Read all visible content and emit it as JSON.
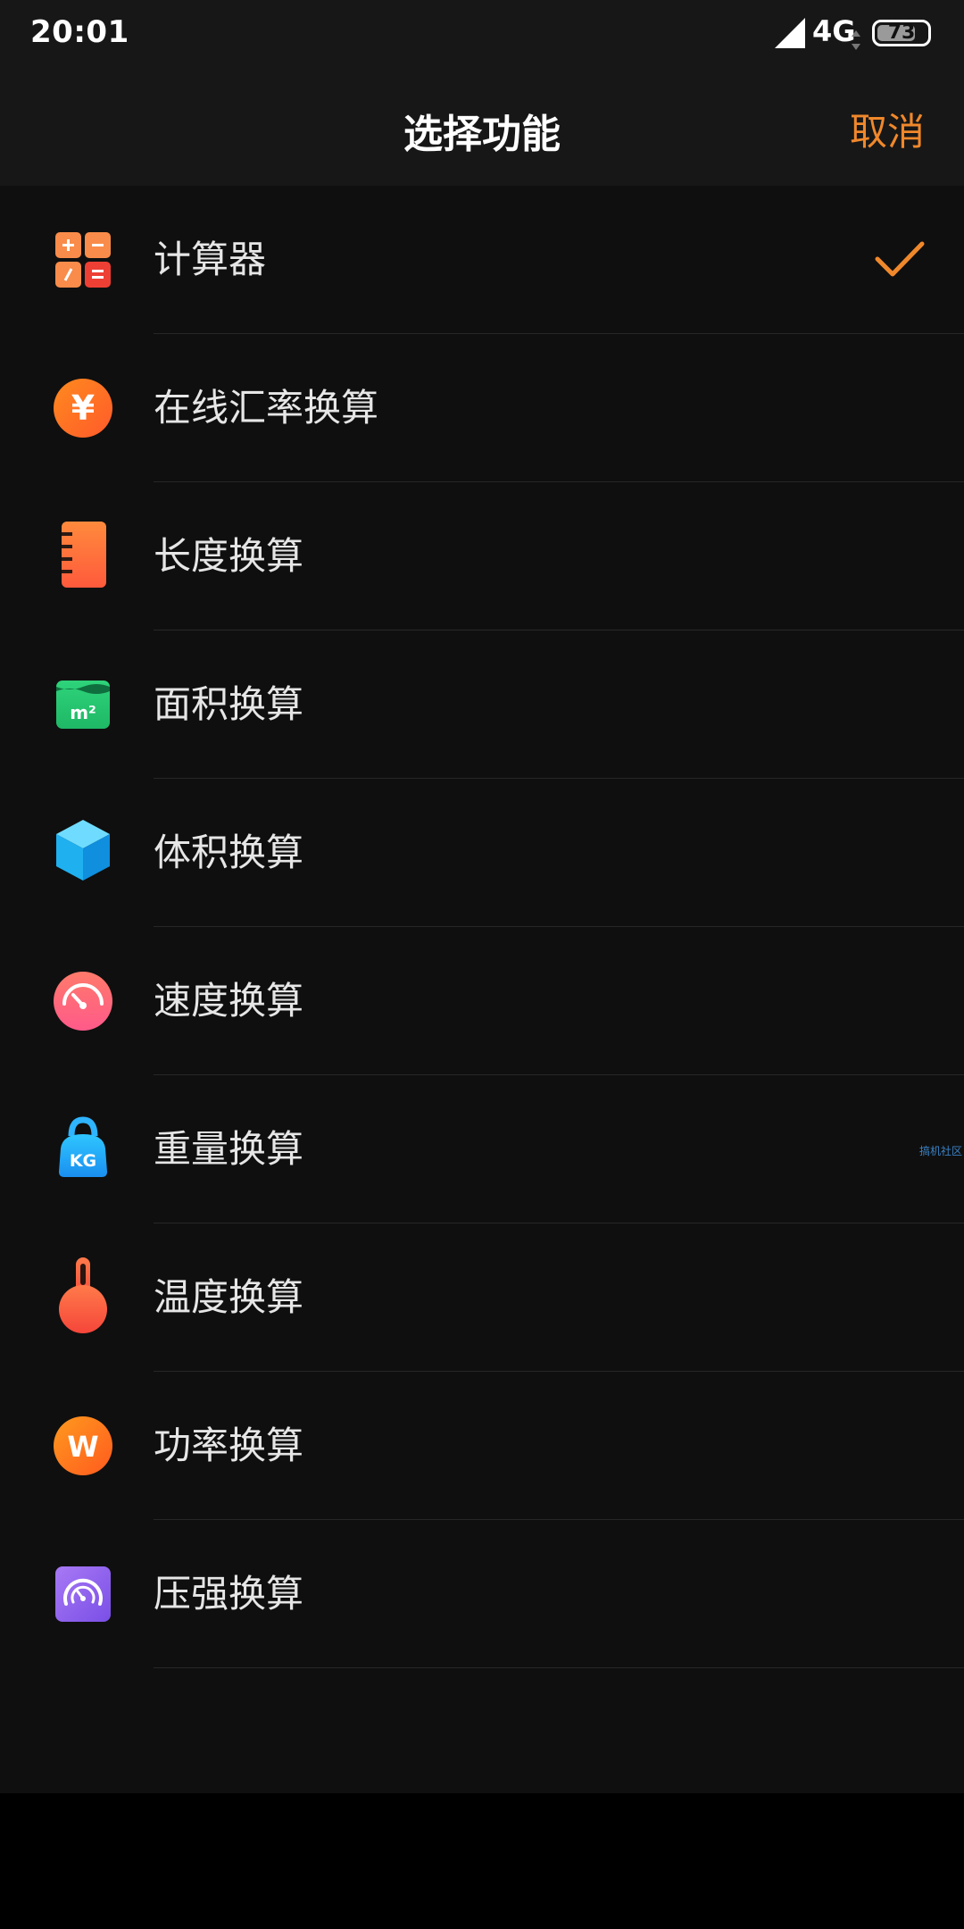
{
  "status_bar": {
    "time": "20:01",
    "network": "4G",
    "battery": "73"
  },
  "header": {
    "title": "选择功能",
    "cancel_label": "取消"
  },
  "items": [
    {
      "label": "计算器",
      "icon": "calculator-icon",
      "selected": true
    },
    {
      "label": "在线汇率换算",
      "icon": "currency-icon",
      "selected": false
    },
    {
      "label": "长度换算",
      "icon": "ruler-icon",
      "selected": false
    },
    {
      "label": "面积换算",
      "icon": "area-icon",
      "selected": false
    },
    {
      "label": "体积换算",
      "icon": "cube-icon",
      "selected": false
    },
    {
      "label": "速度换算",
      "icon": "speedometer-icon",
      "selected": false
    },
    {
      "label": "重量换算",
      "icon": "weight-icon",
      "selected": false
    },
    {
      "label": "温度换算",
      "icon": "thermometer-icon",
      "selected": false
    },
    {
      "label": "功率换算",
      "icon": "power-icon",
      "selected": false
    },
    {
      "label": "压强换算",
      "icon": "pressure-gauge-icon",
      "selected": false
    }
  ],
  "area_icon_text": "m²",
  "currency_icon_text": "¥",
  "weight_icon_text": "KG",
  "power_icon_text": "W",
  "watermark": "搞机社区",
  "colors": {
    "accent": "#f0882b",
    "background": "#0f0f0f",
    "header": "#171717"
  }
}
